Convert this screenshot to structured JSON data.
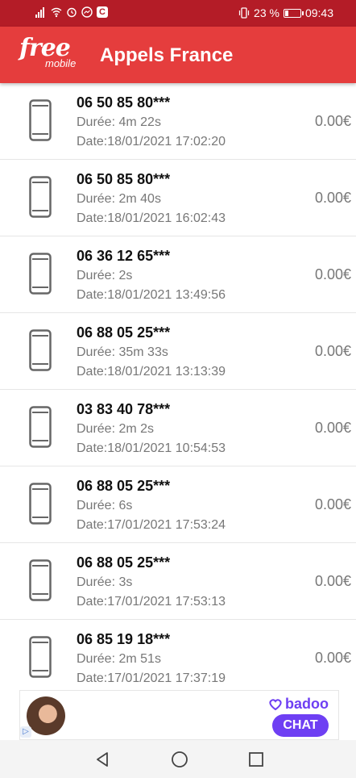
{
  "status_bar": {
    "battery": "23 %",
    "time": "09:43"
  },
  "header": {
    "logo_free": "free",
    "logo_mobile": "mobile",
    "title": "Appels France"
  },
  "calls": [
    {
      "number": "06 50 85 80***",
      "duration": "Durée: 4m 22s",
      "date": "Date:18/01/2021 17:02:20",
      "price": "0.00€"
    },
    {
      "number": "06 50 85 80***",
      "duration": "Durée: 2m 40s",
      "date": "Date:18/01/2021 16:02:43",
      "price": "0.00€"
    },
    {
      "number": "06 36 12 65***",
      "duration": "Durée: 2s",
      "date": "Date:18/01/2021 13:49:56",
      "price": "0.00€"
    },
    {
      "number": "06 88 05 25***",
      "duration": "Durée: 35m 33s",
      "date": "Date:18/01/2021 13:13:39",
      "price": "0.00€"
    },
    {
      "number": "03 83 40 78***",
      "duration": "Durée: 2m 2s",
      "date": "Date:18/01/2021 10:54:53",
      "price": "0.00€"
    },
    {
      "number": "06 88 05 25***",
      "duration": "Durée: 6s",
      "date": "Date:17/01/2021 17:53:24",
      "price": "0.00€"
    },
    {
      "number": "06 88 05 25***",
      "duration": "Durée: 3s",
      "date": "Date:17/01/2021 17:53:13",
      "price": "0.00€"
    },
    {
      "number": "06 85 19 18***",
      "duration": "Durée: 2m 51s",
      "date": "Date:17/01/2021 17:37:19",
      "price": "0.00€"
    }
  ],
  "ad": {
    "brand": "badoo",
    "cta": "CHAT"
  },
  "icons": {
    "call_row": "smartphone-icon",
    "nav": [
      "back-icon",
      "home-icon",
      "recents-icon"
    ]
  },
  "colors": {
    "status_bar": "#b41c27",
    "app_bar": "#e53d3d",
    "badoo": "#6e3ff3"
  }
}
